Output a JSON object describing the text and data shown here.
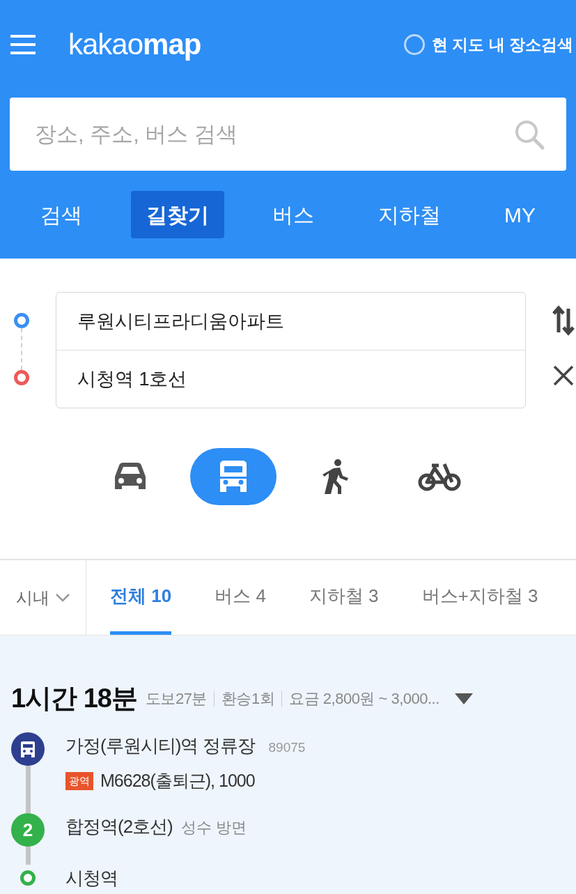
{
  "header": {
    "logo_light": "kakao",
    "logo_bold": "map",
    "area_search": {
      "label": "현 지도 내 장소검색",
      "checked": false
    }
  },
  "search": {
    "placeholder": "장소, 주소, 버스 검색"
  },
  "nav_tabs": [
    {
      "label": "검색",
      "selected": false
    },
    {
      "label": "길찾기",
      "selected": true
    },
    {
      "label": "버스",
      "selected": false
    },
    {
      "label": "지하철",
      "selected": false
    },
    {
      "label": "MY",
      "selected": false
    }
  ],
  "route_inputs": {
    "origin": "루원시티프라디움아파트",
    "destination": "시청역 1호선"
  },
  "modes": [
    {
      "kind": "car",
      "selected": false
    },
    {
      "kind": "bus",
      "selected": true
    },
    {
      "kind": "walk",
      "selected": false
    },
    {
      "kind": "bike",
      "selected": false
    }
  ],
  "region_filter": "시내",
  "result_tabs": [
    {
      "label": "전체 10",
      "selected": true
    },
    {
      "label": "버스 4",
      "selected": false
    },
    {
      "label": "지하철 3",
      "selected": false
    },
    {
      "label": "버스+지하철 3",
      "selected": false
    }
  ],
  "route": {
    "duration": "1시간 18분",
    "walk": "도보27분",
    "transfers": "환승1회",
    "fare": "요금 2,800원 ~ 3,000...",
    "steps": [
      {
        "kind": "bus",
        "color": "#2e3f8f",
        "name": "가정(루원시티)역 정류장",
        "extra": "89075",
        "badge": "광역",
        "lines": "M6628(출퇴근), 1000"
      },
      {
        "kind": "subway",
        "color": "#33b14a",
        "marker": "2",
        "name": "합정역(2호선)",
        "extra": "성수 방면"
      },
      {
        "kind": "end",
        "color": "#33b14a",
        "name": "시청역"
      }
    ]
  }
}
